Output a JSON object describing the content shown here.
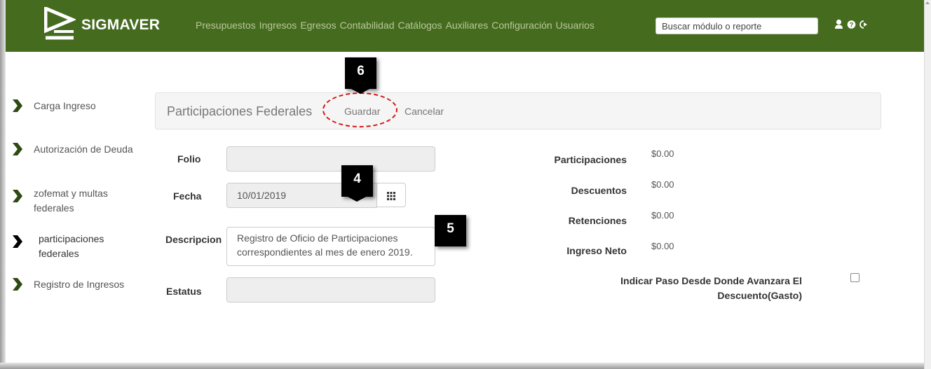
{
  "nav": {
    "brand": "SIGMAVER",
    "menu": [
      "Presupuestos",
      "Ingresos",
      "Egresos",
      "Contabilidad",
      "Catálogos",
      "Auxiliares",
      "Configuración",
      "Usuarios"
    ],
    "search_placeholder": "Buscar módulo o reporte",
    "icons": [
      "user-icon",
      "help-icon",
      "logout-icon"
    ],
    "bg_color": "#456b1f",
    "menu_color": "#b9c89a"
  },
  "sidebar": {
    "items": [
      {
        "label": "Carga Ingreso",
        "active": false
      },
      {
        "label": "Autorización de Deuda",
        "active": false
      },
      {
        "label": "zofemat y multas federales",
        "active": false
      },
      {
        "label": "participaciones federales",
        "active": true
      },
      {
        "label": "Registro de Ingresos",
        "active": false
      }
    ],
    "chevron_color": "#2e4a12",
    "active_chevron_color": "#000000"
  },
  "panel": {
    "title": "Participaciones Federales",
    "save_label": "Guardar",
    "cancel_label": "Cancelar"
  },
  "form": {
    "folio_label": "Folio",
    "folio_value": "",
    "fecha_label": "Fecha",
    "fecha_value": "10/01/2019",
    "descripcion_label": "Descripcion",
    "descripcion_value": "Registro de Oficio de Participaciones correspondientes al mes de enero 2019.",
    "estatus_label": "Estatus",
    "estatus_value": ""
  },
  "totals": {
    "participaciones_label": "Participaciones",
    "participaciones_value": "$0.00",
    "descuentos_label": "Descuentos",
    "descuentos_value": "$0.00",
    "retenciones_label": "Retenciones",
    "retenciones_value": "$0.00",
    "ingreso_neto_label": "Ingreso Neto",
    "ingreso_neto_value": "$0.00"
  },
  "checkbox": {
    "label_line1": "Indicar Paso Desde Donde Avanzara El",
    "label_line2": "Descuento(Gasto)",
    "checked": false
  },
  "annotations": {
    "badge_6": "6",
    "badge_4": "4",
    "badge_5": "5",
    "highlight_color": "#d41515"
  }
}
